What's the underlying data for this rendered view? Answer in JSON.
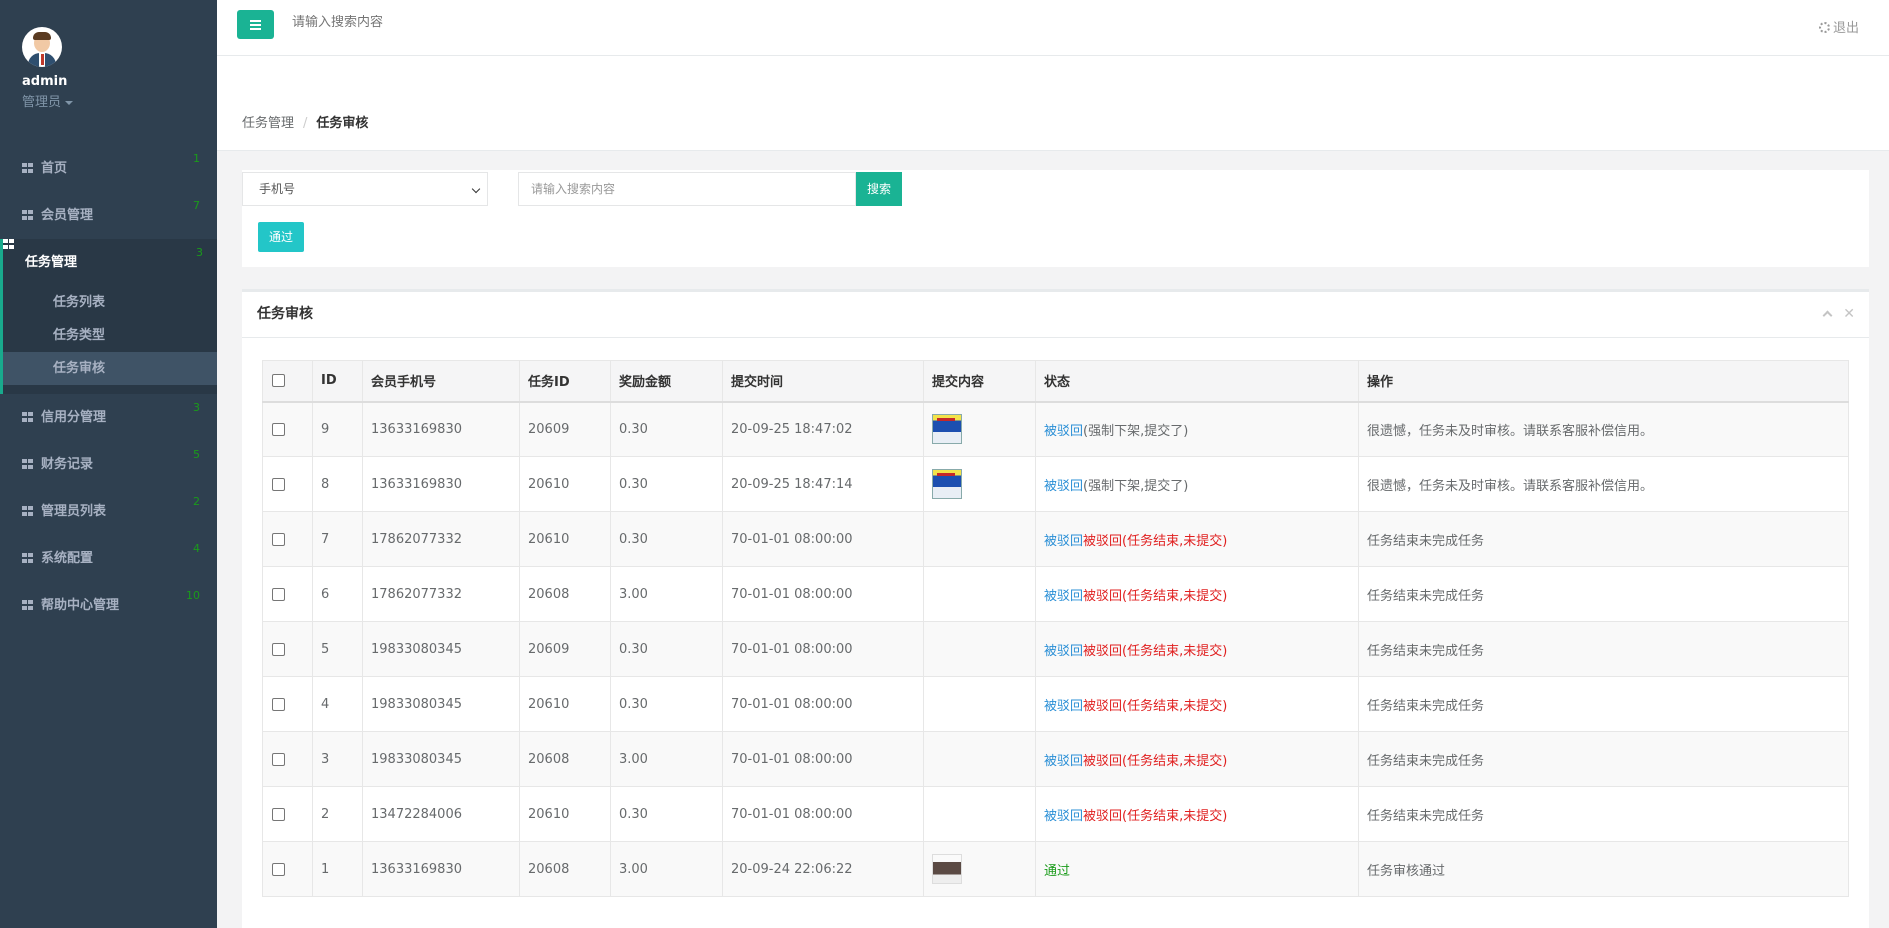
{
  "sidebar": {
    "username": "admin",
    "role": "管理员",
    "nav": [
      {
        "label": "首页",
        "badge": "1"
      },
      {
        "label": "会员管理",
        "badge": "7"
      }
    ],
    "active": {
      "label": "任务管理",
      "badge": "3",
      "children": [
        "任务列表",
        "任务类型",
        "任务审核"
      ]
    },
    "nav_after": [
      {
        "label": "信用分管理",
        "badge": "3"
      },
      {
        "label": "财务记录",
        "badge": "5"
      },
      {
        "label": "管理员列表",
        "badge": "2"
      },
      {
        "label": "系统配置",
        "badge": "4"
      },
      {
        "label": "帮助中心管理",
        "badge": "10"
      }
    ]
  },
  "topbar": {
    "search_placeholder": "请输入搜索内容",
    "logout_label": "退出"
  },
  "breadcrumb": {
    "parent": "任务管理",
    "current": "任务审核"
  },
  "filter": {
    "select_value": "手机号",
    "keyword_placeholder": "请输入搜索内容",
    "search_label": "搜索",
    "pass_label": "通过"
  },
  "panel": {
    "title": "任务审核",
    "columns": [
      "ID",
      "会员手机号",
      "任务ID",
      "奖励金额",
      "提交时间",
      "提交内容",
      "状态",
      "操作"
    ],
    "rows": [
      {
        "id": "9",
        "phone": "13633169830",
        "task_id": "20609",
        "amount": "0.30",
        "time": "20-09-25 18:47:02",
        "thumb": "ach",
        "status_link": "被驳回",
        "status_text": "(强制下架,提交了)",
        "status_kind": "normal",
        "op": "很遗憾，任务未及时审核。请联系客服补偿信用。"
      },
      {
        "id": "8",
        "phone": "13633169830",
        "task_id": "20610",
        "amount": "0.30",
        "time": "20-09-25 18:47:14",
        "thumb": "ach",
        "status_link": "被驳回",
        "status_text": "(强制下架,提交了)",
        "status_kind": "normal",
        "op": "很遗憾，任务未及时审核。请联系客服补偿信用。"
      },
      {
        "id": "7",
        "phone": "17862077332",
        "task_id": "20610",
        "amount": "0.30",
        "time": "70-01-01 08:00:00",
        "thumb": "",
        "status_link": "被驳回",
        "status_text": "被驳回(任务结束,未提交)",
        "status_kind": "red",
        "op": "任务结束未完成任务"
      },
      {
        "id": "6",
        "phone": "17862077332",
        "task_id": "20608",
        "amount": "3.00",
        "time": "70-01-01 08:00:00",
        "thumb": "",
        "status_link": "被驳回",
        "status_text": "被驳回(任务结束,未提交)",
        "status_kind": "red",
        "op": "任务结束未完成任务"
      },
      {
        "id": "5",
        "phone": "19833080345",
        "task_id": "20609",
        "amount": "0.30",
        "time": "70-01-01 08:00:00",
        "thumb": "",
        "status_link": "被驳回",
        "status_text": "被驳回(任务结束,未提交)",
        "status_kind": "red",
        "op": "任务结束未完成任务"
      },
      {
        "id": "4",
        "phone": "19833080345",
        "task_id": "20610",
        "amount": "0.30",
        "time": "70-01-01 08:00:00",
        "thumb": "",
        "status_link": "被驳回",
        "status_text": "被驳回(任务结束,未提交)",
        "status_kind": "red",
        "op": "任务结束未完成任务"
      },
      {
        "id": "3",
        "phone": "19833080345",
        "task_id": "20608",
        "amount": "3.00",
        "time": "70-01-01 08:00:00",
        "thumb": "",
        "status_link": "被驳回",
        "status_text": "被驳回(任务结束,未提交)",
        "status_kind": "red",
        "op": "任务结束未完成任务"
      },
      {
        "id": "2",
        "phone": "13472284006",
        "task_id": "20610",
        "amount": "0.30",
        "time": "70-01-01 08:00:00",
        "thumb": "",
        "status_link": "被驳回",
        "status_text": "被驳回(任务结束,未提交)",
        "status_kind": "red",
        "op": "任务结束未完成任务"
      },
      {
        "id": "1",
        "phone": "13633169830",
        "task_id": "20608",
        "amount": "3.00",
        "time": "20-09-24 22:06:22",
        "thumb": "photo",
        "status_link": "",
        "status_text": "通过",
        "status_kind": "green",
        "op": "任务审核通过"
      }
    ]
  },
  "colors": {
    "sidebar": "#2f4050",
    "accent": "#1ab394",
    "info": "#23c6c8",
    "link": "#2a8fd6",
    "danger": "#e02020",
    "success": "#1a9b1a"
  }
}
